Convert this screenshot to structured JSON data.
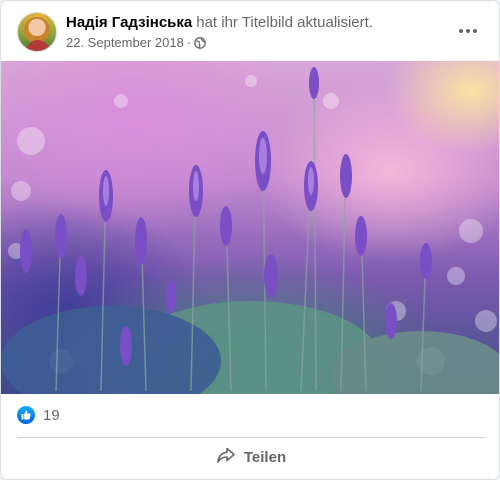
{
  "post": {
    "author": "Надія Гадзінська",
    "action": "hat ihr Titelbild aktualisiert.",
    "date": "22. September 2018",
    "separator": "·",
    "privacy_icon": "globe-icon",
    "more_icon": "more-options-icon"
  },
  "photo": {
    "subject": "lavender-field"
  },
  "reactions": {
    "icon": "like-icon",
    "count": "19"
  },
  "actions": {
    "share_label": "Teilen",
    "share_icon": "share-arrow-icon"
  },
  "colors": {
    "like_blue": "#1877f2",
    "secondary_text": "#65676b",
    "primary_text": "#050505"
  }
}
